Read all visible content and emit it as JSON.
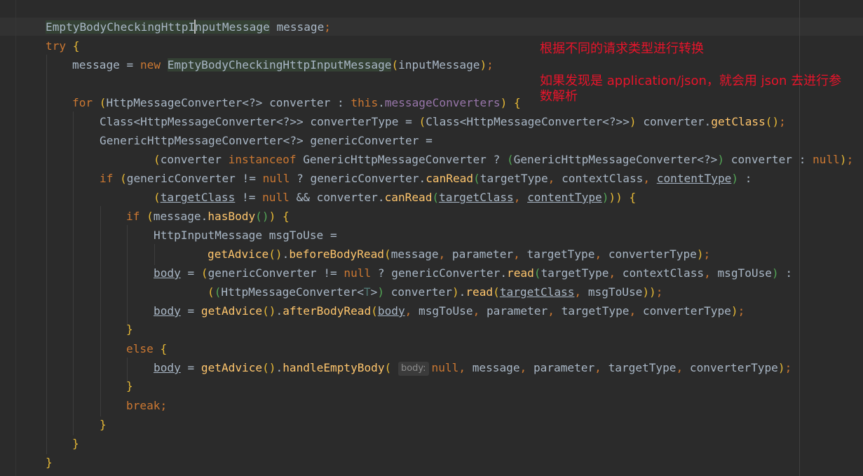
{
  "annotation": {
    "line1": "根据不同的请求类型进行转换",
    "line2": "如果发现是 application/json，就会用 json 去进行参数解析"
  },
  "editor": {
    "hint_label": "body:",
    "lines": [
      "EmptyBodyCheckingHttpInputMessage message;",
      "try {",
      "message = new EmptyBodyCheckingHttpInputMessage(inputMessage);",
      "",
      "for (HttpMessageConverter<?> converter : this.messageConverters) {",
      "Class<HttpMessageConverter<?>> converterType = (Class<HttpMessageConverter<?>>) converter.getClass();",
      "GenericHttpMessageConverter<?> genericConverter =",
      "(converter instanceof GenericHttpMessageConverter ? (GenericHttpMessageConverter<?>) converter : null);",
      "if (genericConverter != null ? genericConverter.canRead(targetType, contextClass, contentType) :",
      "(targetClass != null && converter.canRead(targetClass, contentType))) {",
      "if (message.hasBody()) {",
      "HttpInputMessage msgToUse =",
      "getAdvice().beforeBodyRead(message, parameter, targetType, converterType);",
      "body = (genericConverter != null ? genericConverter.read(targetType, contextClass, msgToUse) :",
      "((HttpMessageConverter<T>) converter).read(targetClass, msgToUse));",
      "body = getAdvice().afterBodyRead(body, msgToUse, parameter, targetType, converterType);",
      "}",
      "else {",
      "body = getAdvice().handleEmptyBody( body: null, message, parameter, targetType, converterType);",
      "}",
      "break;",
      "}",
      "}",
      "}"
    ]
  }
}
